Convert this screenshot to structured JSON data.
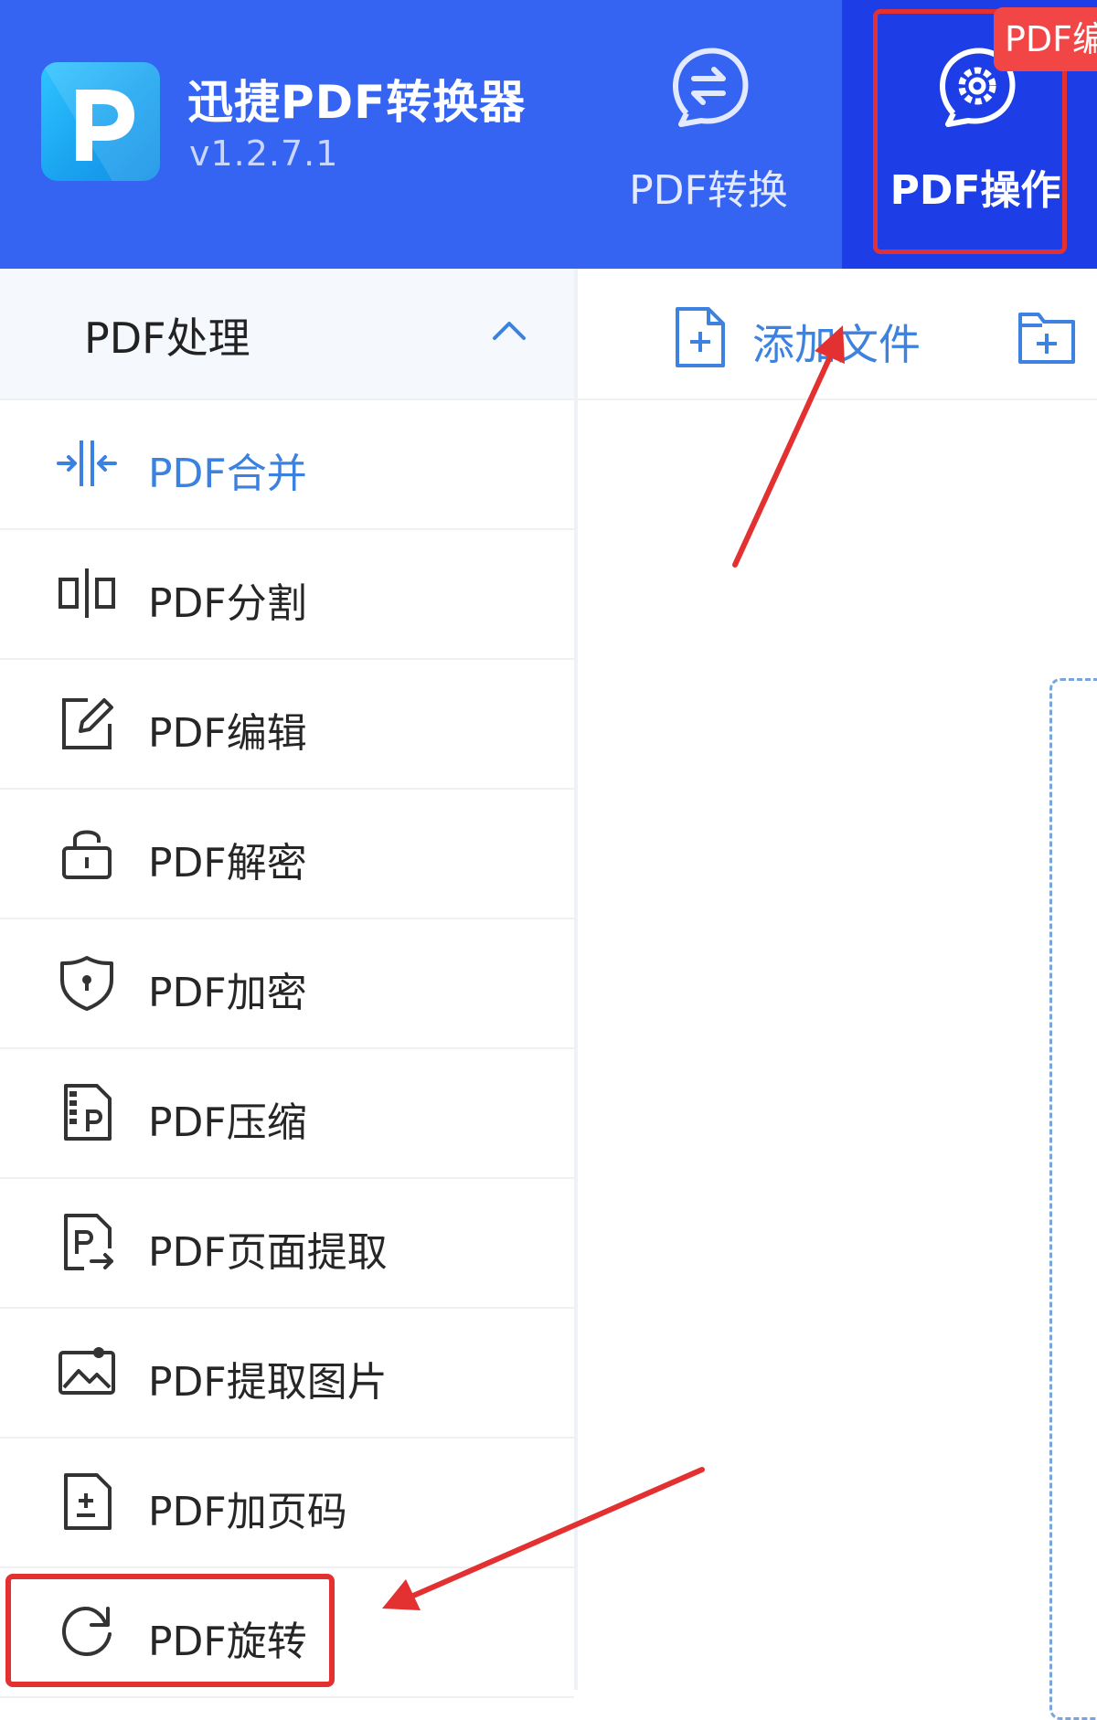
{
  "header": {
    "app_name": "迅捷PDF转换器",
    "version": "v1.2.7.1",
    "tabs": [
      {
        "label": "PDF转换",
        "icon": "convert-arrows-icon",
        "active": false
      },
      {
        "label": "PDF操作",
        "icon": "gear-icon",
        "active": true
      }
    ],
    "corner_badge": "PDF编"
  },
  "sidebar": {
    "section_title": "PDF处理",
    "section_expanded": true,
    "items": [
      {
        "label": "PDF合并",
        "icon": "merge-icon",
        "active": true
      },
      {
        "label": "PDF分割",
        "icon": "split-icon",
        "active": false
      },
      {
        "label": "PDF编辑",
        "icon": "edit-icon",
        "active": false
      },
      {
        "label": "PDF解密",
        "icon": "unlock-icon",
        "active": false
      },
      {
        "label": "PDF加密",
        "icon": "shield-lock-icon",
        "active": false
      },
      {
        "label": "PDF压缩",
        "icon": "compress-file-icon",
        "active": false
      },
      {
        "label": "PDF页面提取",
        "icon": "page-extract-icon",
        "active": false
      },
      {
        "label": "PDF提取图片",
        "icon": "image-extract-icon",
        "active": false
      },
      {
        "label": "PDF加页码",
        "icon": "page-number-icon",
        "active": false
      },
      {
        "label": "PDF旋转",
        "icon": "rotate-icon",
        "active": false
      }
    ]
  },
  "toolbar": {
    "add_file_label": "添加文件",
    "add_file_icon": "add-file-icon",
    "add_folder_icon": "add-folder-icon"
  },
  "colors": {
    "header_bg": "#3564f2",
    "active_tab_bg": "#1d3ee6",
    "accent": "#3b82e0",
    "annotation_red": "#e33131"
  }
}
